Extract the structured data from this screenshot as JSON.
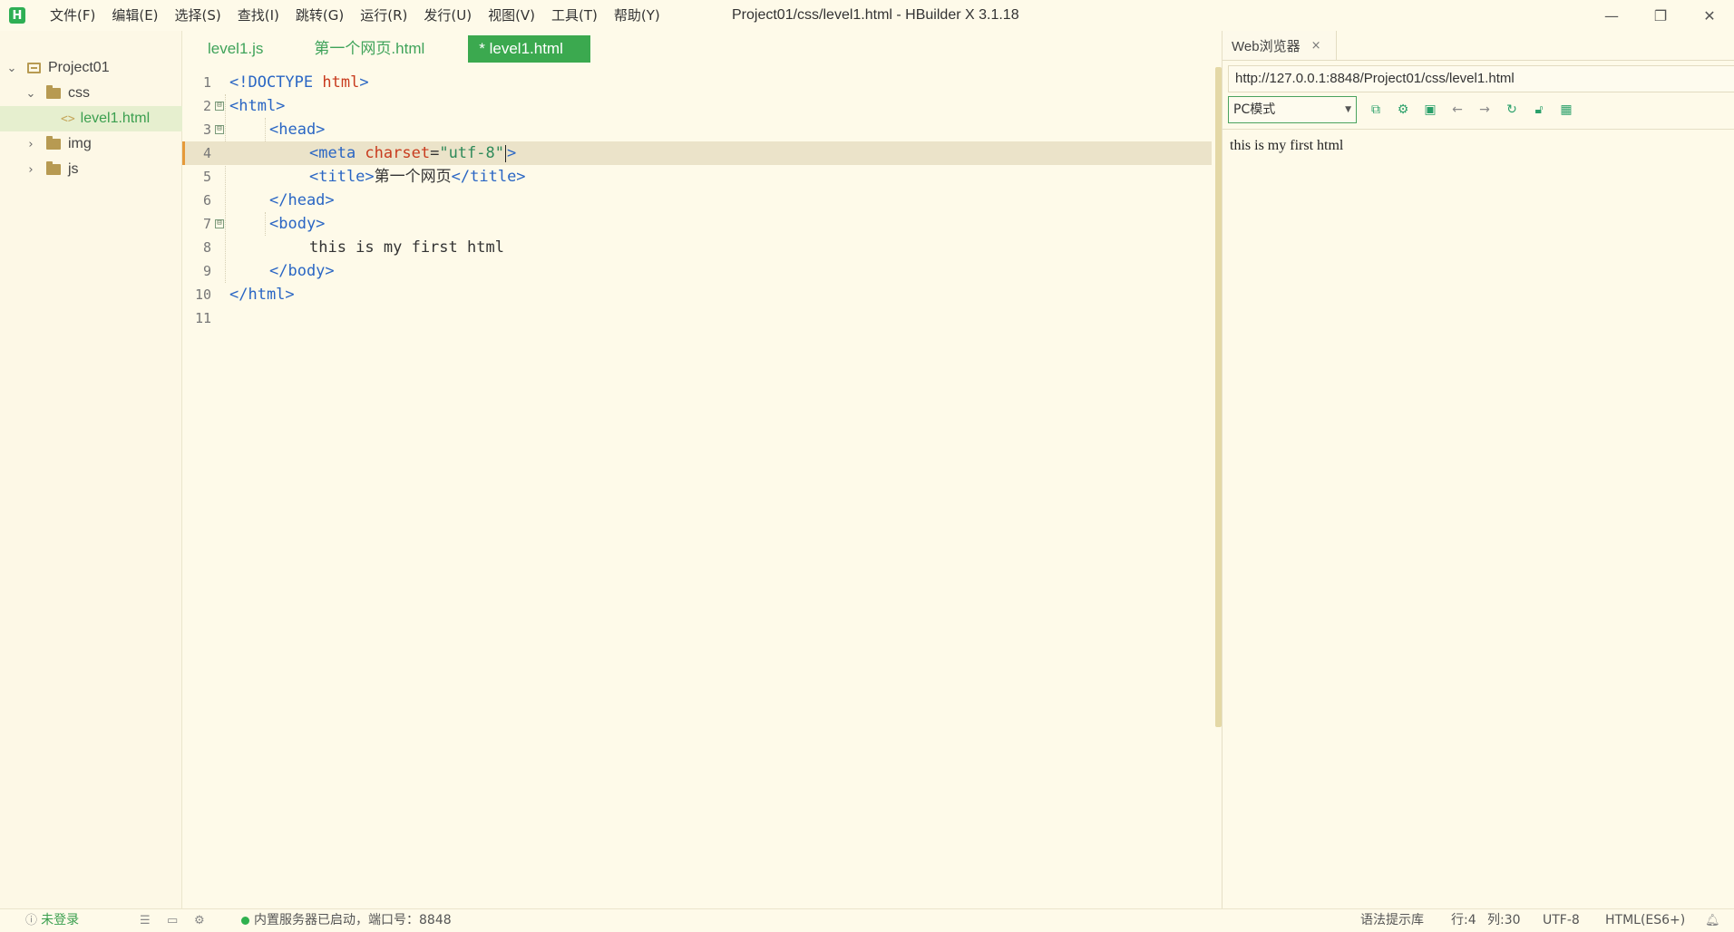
{
  "app": {
    "logo_letter": "H",
    "window_title": "Project01/css/level1.html - HBuilder X 3.1.18",
    "menu": [
      "文件(F)",
      "编辑(E)",
      "选择(S)",
      "查找(I)",
      "跳转(G)",
      "运行(R)",
      "发行(U)",
      "视图(V)",
      "工具(T)",
      "帮助(Y)"
    ],
    "window_controls": {
      "minimize": "—",
      "restore": "❐",
      "close": "✕"
    }
  },
  "sidebar": {
    "items": [
      {
        "label": "Project01",
        "type": "project",
        "arrow": "⌄"
      },
      {
        "label": "css",
        "type": "folder",
        "arrow": "⌄"
      },
      {
        "label": "level1.html",
        "type": "file",
        "icon": "<>",
        "selected": true
      },
      {
        "label": "img",
        "type": "folder",
        "arrow": "›"
      },
      {
        "label": "js",
        "type": "folder",
        "arrow": "›"
      }
    ]
  },
  "editor": {
    "tabs": [
      {
        "label": "level1.js",
        "active": false
      },
      {
        "label": "第一个网页.html",
        "active": false
      },
      {
        "label": "* level1.html",
        "active": true
      }
    ],
    "line_numbers": [
      "1",
      "2",
      "3",
      "4",
      "5",
      "6",
      "7",
      "8",
      "9",
      "10",
      "11"
    ],
    "current_line": 4,
    "code": {
      "l1_doctype": "<!DOCTYPE",
      "l1_html": " html",
      "l1_close": ">",
      "l2": "<html>",
      "l3": "<head>",
      "l4_open": "<meta",
      "l4_attr": " charset",
      "l4_eq": "=",
      "l4_val": "\"utf-8\"",
      "l4_close": ">",
      "l5_open": "<title>",
      "l5_text": "第一个网页",
      "l5_close": "</title>",
      "l6": "</head>",
      "l7": "<body>",
      "l8": "this is my first html",
      "l9": "</body>",
      "l10": "</html>"
    },
    "fold_marker": "⊟"
  },
  "browser": {
    "tab_label": "Web浏览器",
    "tab_close": "×",
    "url": "http://127.0.0.1:8848/Project01/css/level1.html",
    "mode": "PC模式",
    "tools": [
      "open-external-icon",
      "settings-icon",
      "console-icon",
      "back-icon",
      "forward-icon",
      "refresh-icon",
      "lock-icon",
      "qrcode-icon"
    ],
    "page_text": "this is my first html"
  },
  "statusbar": {
    "login": "未登录",
    "server_status": "内置服务器已启动，端口号：8848",
    "syntax_lib": "语法提示库",
    "line": "行:4",
    "column": "列:30",
    "encoding": "UTF-8",
    "language": "HTML(ES6+)"
  },
  "colors": {
    "accent_green": "#3ba94f",
    "background": "#fefae9",
    "tag_blue": "#2a66c4",
    "attr_red": "#c83b1e",
    "string_green": "#2f8a5a"
  }
}
